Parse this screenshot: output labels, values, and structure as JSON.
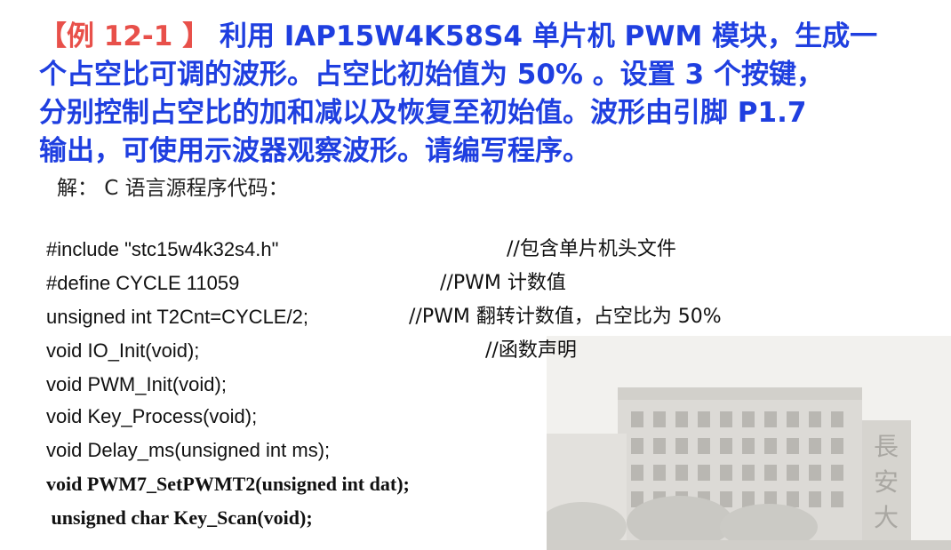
{
  "title": {
    "label": "【例 12-1 】",
    "lines": [
      " 利用 IAP15W4K58S4 单片机 PWM 模块，生成一",
      "个占空比可调的波形。占空比初始值为 50% 。设置 3 个按键，",
      "分别控制占空比的加和减以及恢复至初始值。波形由引脚 P1.7",
      "输出，可使用示波器观察波形。请编写程序。"
    ]
  },
  "solution_text": "解： C 语言源程序代码：",
  "code": [
    {
      "text": "#include \"stc15w4k32s4.h\"",
      "comment": "//包含单片机头文件"
    },
    {
      "text": "#define CYCLE 11059",
      "comment": "//PWM 计数值"
    },
    {
      "text": "unsigned int T2Cnt=CYCLE/2;",
      "comment": "//PWM 翻转计数值，占空比为 50%"
    },
    {
      "text": "void IO_Init(void);",
      "comment": "//函数声明"
    },
    {
      "text": "void PWM_Init(void);",
      "comment": ""
    },
    {
      "text": "void Key_Process(void);",
      "comment": ""
    },
    {
      "text": "void Delay_ms(unsigned int ms);",
      "comment": ""
    },
    {
      "text": "void PWM7_SetPWMT2(unsigned int dat);",
      "comment": ""
    },
    {
      "text": " unsigned char Key_Scan(void);",
      "comment": ""
    }
  ],
  "photo_sign_text": "長安大"
}
